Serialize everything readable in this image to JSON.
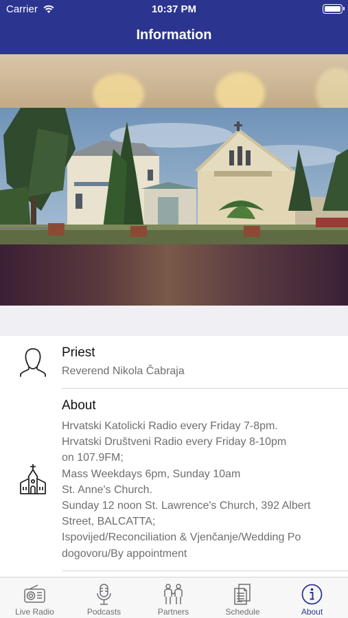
{
  "status_bar": {
    "carrier": "Carrier",
    "time": "10:37 PM"
  },
  "nav": {
    "title": "Information"
  },
  "hero": {
    "image_description": ""
  },
  "priest": {
    "title": "Priest",
    "name": "Reverend Nikola Čabraja"
  },
  "about": {
    "title": "About",
    "lines": [
      "Hrvatski Katolicki Radio every Friday 7-8pm.",
      "Hrvatski Društveni Radio every Friday 8-10pm",
      "on 107.9FM;",
      "Mass Weekdays 6pm, Sunday 10am",
      "St. Anne's Church.",
      "Sunday 12 noon St. Lawrence's Church, 392 Albert",
      "Street, BALCATTA;",
      "Ispovijed/Reconciliation & Vjenčanje/Wedding Po",
      "dogovoru/By appointment"
    ]
  },
  "tabs": [
    {
      "label": "Live Radio",
      "icon": "radio-icon",
      "active": false
    },
    {
      "label": "Podcasts",
      "icon": "microphone-icon",
      "active": false
    },
    {
      "label": "Partners",
      "icon": "people-icon",
      "active": false
    },
    {
      "label": "Schedule",
      "icon": "document-icon",
      "active": false
    },
    {
      "label": "About",
      "icon": "info-icon",
      "active": true
    }
  ],
  "colors": {
    "brand": "#2b3590",
    "tab_inactive": "#6d6d72"
  }
}
